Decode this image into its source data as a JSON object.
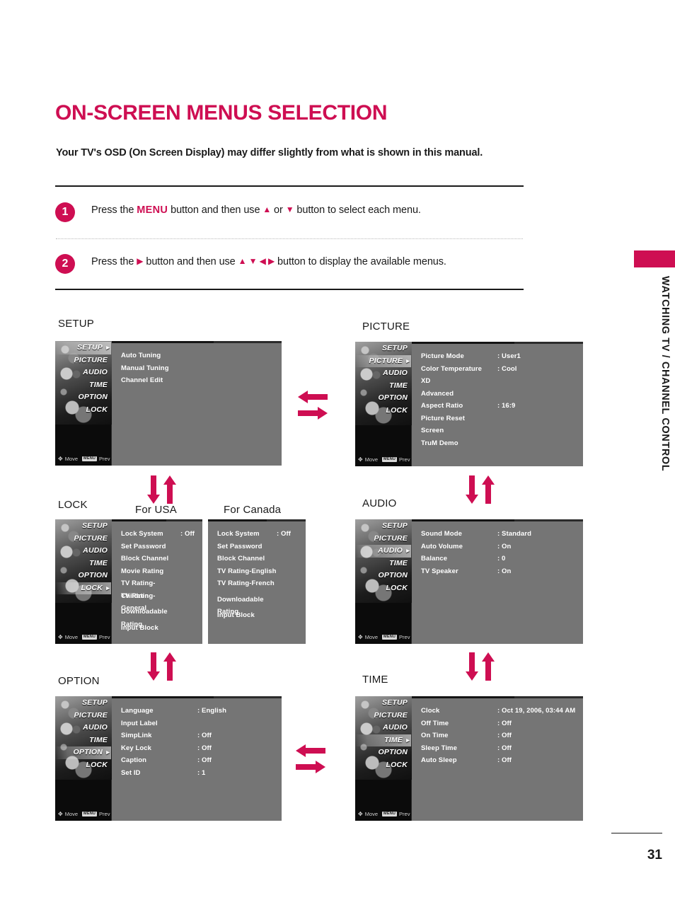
{
  "header": {
    "title": "ON-SCREEN MENUS SELECTION",
    "subtitle": "Your TV's OSD (On Screen Display) may differ slightly from what is shown in this manual."
  },
  "steps": [
    {
      "number": "1",
      "before": "Press the ",
      "keyword": "MENU",
      "middle": " button and then use ",
      "arrows_a": "▲",
      "conjunction": " or ",
      "arrows_b": "▼",
      "after": " button to select each menu."
    },
    {
      "number": "2",
      "before": "Press the ",
      "keyword": "▶",
      "middle": " button and then use ",
      "arrows_a": "▲ ▼ ◀ ▶",
      "conjunction": "",
      "arrows_b": "",
      "after": " button to display the available menus."
    }
  ],
  "sections": {
    "setup_label": "SETUP",
    "picture_label": "PICTURE",
    "lock_label": "LOCK",
    "lock_usa_label": "For USA",
    "lock_canada_label": "For Canada",
    "audio_label": "AUDIO",
    "option_label": "OPTION",
    "time_label": "TIME"
  },
  "osd_sidebar": {
    "items": [
      "SETUP",
      "PICTURE",
      "AUDIO",
      "TIME",
      "OPTION",
      "LOCK"
    ],
    "hint_move": "Move",
    "hint_menu_key": "MENU",
    "hint_prev": "Prev"
  },
  "menus": {
    "setup": {
      "active": "SETUP",
      "rows": [
        {
          "label": "Auto Tuning",
          "value": ""
        },
        {
          "label": "Manual Tuning",
          "value": ""
        },
        {
          "label": "Channel Edit",
          "value": ""
        }
      ]
    },
    "picture": {
      "active": "PICTURE",
      "rows": [
        {
          "label": "Picture Mode",
          "value": ": User1"
        },
        {
          "label": "Color Temperature",
          "value": ": Cool"
        },
        {
          "label": "XD",
          "value": ""
        },
        {
          "label": "Advanced",
          "value": ""
        },
        {
          "label": "Aspect Ratio",
          "value": ": 16:9"
        },
        {
          "label": "Picture Reset",
          "value": ""
        },
        {
          "label": "Screen",
          "value": ""
        },
        {
          "label": "TruM Demo",
          "value": ""
        }
      ]
    },
    "lock_usa": {
      "active": "LOCK",
      "rows": [
        {
          "label": "Lock System",
          "value": ": Off"
        },
        {
          "label": "Set Password",
          "value": ""
        },
        {
          "label": "Block Channel",
          "value": ""
        },
        {
          "label": "Movie Rating",
          "value": ""
        },
        {
          "label": "TV Rating-Children",
          "value": ""
        },
        {
          "label": "TV Rating-General",
          "value": ""
        },
        {
          "label": "Downloadable Rating",
          "value": ""
        },
        {
          "label": "Input Block",
          "value": ""
        }
      ]
    },
    "lock_canada": {
      "rows": [
        {
          "label": "Lock System",
          "value": ": Off"
        },
        {
          "label": "Set Password",
          "value": ""
        },
        {
          "label": "Block Channel",
          "value": ""
        },
        {
          "label": "TV Rating-English",
          "value": ""
        },
        {
          "label": "TV Rating-French",
          "value": ""
        },
        {
          "label": "Downloadable Rating",
          "value": ""
        },
        {
          "label": "Input Block",
          "value": ""
        }
      ]
    },
    "audio": {
      "active": "AUDIO",
      "rows": [
        {
          "label": "Sound Mode",
          "value": ": Standard"
        },
        {
          "label": "Auto Volume",
          "value": ": On"
        },
        {
          "label": "Balance",
          "value": ": 0"
        },
        {
          "label": "TV Speaker",
          "value": ": On"
        }
      ]
    },
    "option": {
      "active": "OPTION",
      "rows": [
        {
          "label": "Language",
          "value": ": English"
        },
        {
          "label": "Input Label",
          "value": ""
        },
        {
          "label": "SimpLink",
          "value": ": Off"
        },
        {
          "label": "Key Lock",
          "value": ": Off"
        },
        {
          "label": "Caption",
          "value": ": Off"
        },
        {
          "label": "Set ID",
          "value": ": 1"
        }
      ]
    },
    "time": {
      "active": "TIME",
      "rows": [
        {
          "label": "Clock",
          "value": ": Oct 19, 2006, 03:44 AM"
        },
        {
          "label": "Off Time",
          "value": ": Off"
        },
        {
          "label": "On Time",
          "value": ": Off"
        },
        {
          "label": "Sleep Time",
          "value": ": Off"
        },
        {
          "label": "Auto Sleep",
          "value": ": Off"
        }
      ]
    }
  },
  "side_tab": {
    "text": "WATCHING TV / CHANNEL CONTROL"
  },
  "footer": {
    "page_number": "31"
  },
  "colors": {
    "accent": "#ce0e52",
    "osd_panel": "#757575",
    "osd_sidebar": "#0b0b0b"
  }
}
